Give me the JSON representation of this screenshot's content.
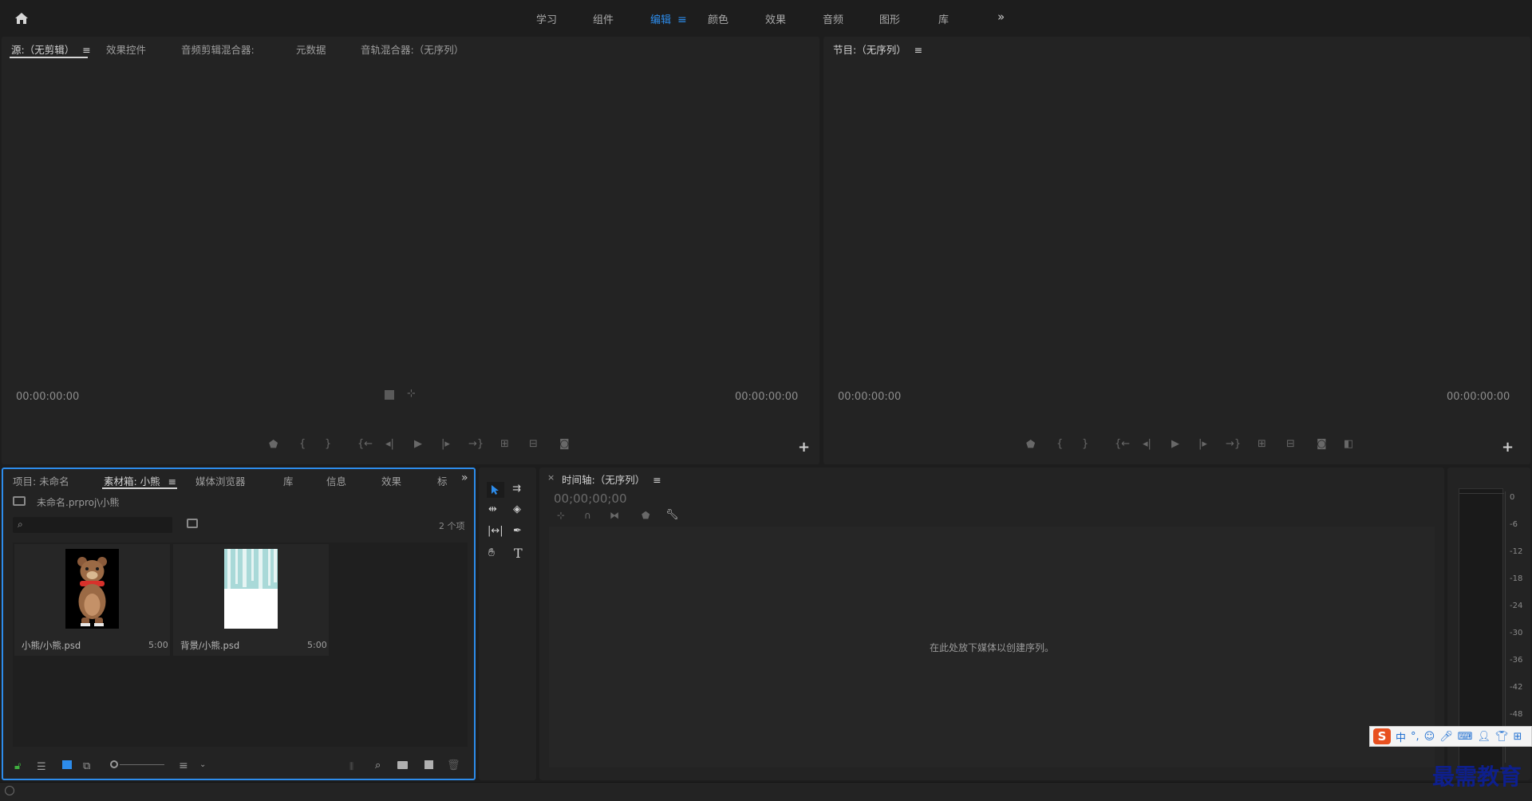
{
  "workspace_tabs": [
    {
      "label": "学习"
    },
    {
      "label": "组件"
    },
    {
      "label": "编辑",
      "active": true
    },
    {
      "label": "颜色"
    },
    {
      "label": "效果"
    },
    {
      "label": "音频"
    },
    {
      "label": "图形"
    },
    {
      "label": "库"
    }
  ],
  "workspace_menu_glyph": "≡",
  "more_glyph": "»",
  "source_panel": {
    "tabs": [
      "源:（无剪辑）",
      "效果控件",
      "音频剪辑混合器:",
      "元数据",
      "音轨混合器:（无序列）"
    ],
    "menu_glyph": "≡",
    "timecode_left": "00:00:00:00",
    "timecode_right": "00:00:00:00"
  },
  "program_panel": {
    "tab": "节目:（无序列）",
    "menu_glyph": "≡",
    "timecode_left": "00:00:00:00",
    "timecode_right": "00:00:00:00"
  },
  "project_panel": {
    "tabs": [
      "项目: 未命名",
      "素材箱: 小熊",
      "媒体浏览器",
      "库",
      "信息",
      "效果",
      "标"
    ],
    "menu_glyph": "≡",
    "path": "未命名.prproj\\小熊",
    "search_placeholder": "",
    "item_count": "2 个项",
    "items": [
      {
        "name": "小熊/小熊.psd",
        "duration": "5:00"
      },
      {
        "name": "背景/小熊.psd",
        "duration": "5:00"
      }
    ]
  },
  "timeline_panel": {
    "close_glyph": "×",
    "tab": "时间轴:（无序列）",
    "menu_glyph": "≡",
    "timecode": "00;00;00;00",
    "empty_message": "在此处放下媒体以创建序列。"
  },
  "audio_meter": {
    "ticks": [
      "0",
      "-6",
      "-12",
      "-18",
      "-24",
      "-30",
      "-36",
      "-42",
      "-48"
    ]
  },
  "ime": {
    "zh": "中",
    "punct": "°,"
  },
  "watermark": "最需教育",
  "colors": {
    "accent": "#2d8ceb",
    "panel_bg": "#232323",
    "app_bg": "#1d1d1d"
  }
}
